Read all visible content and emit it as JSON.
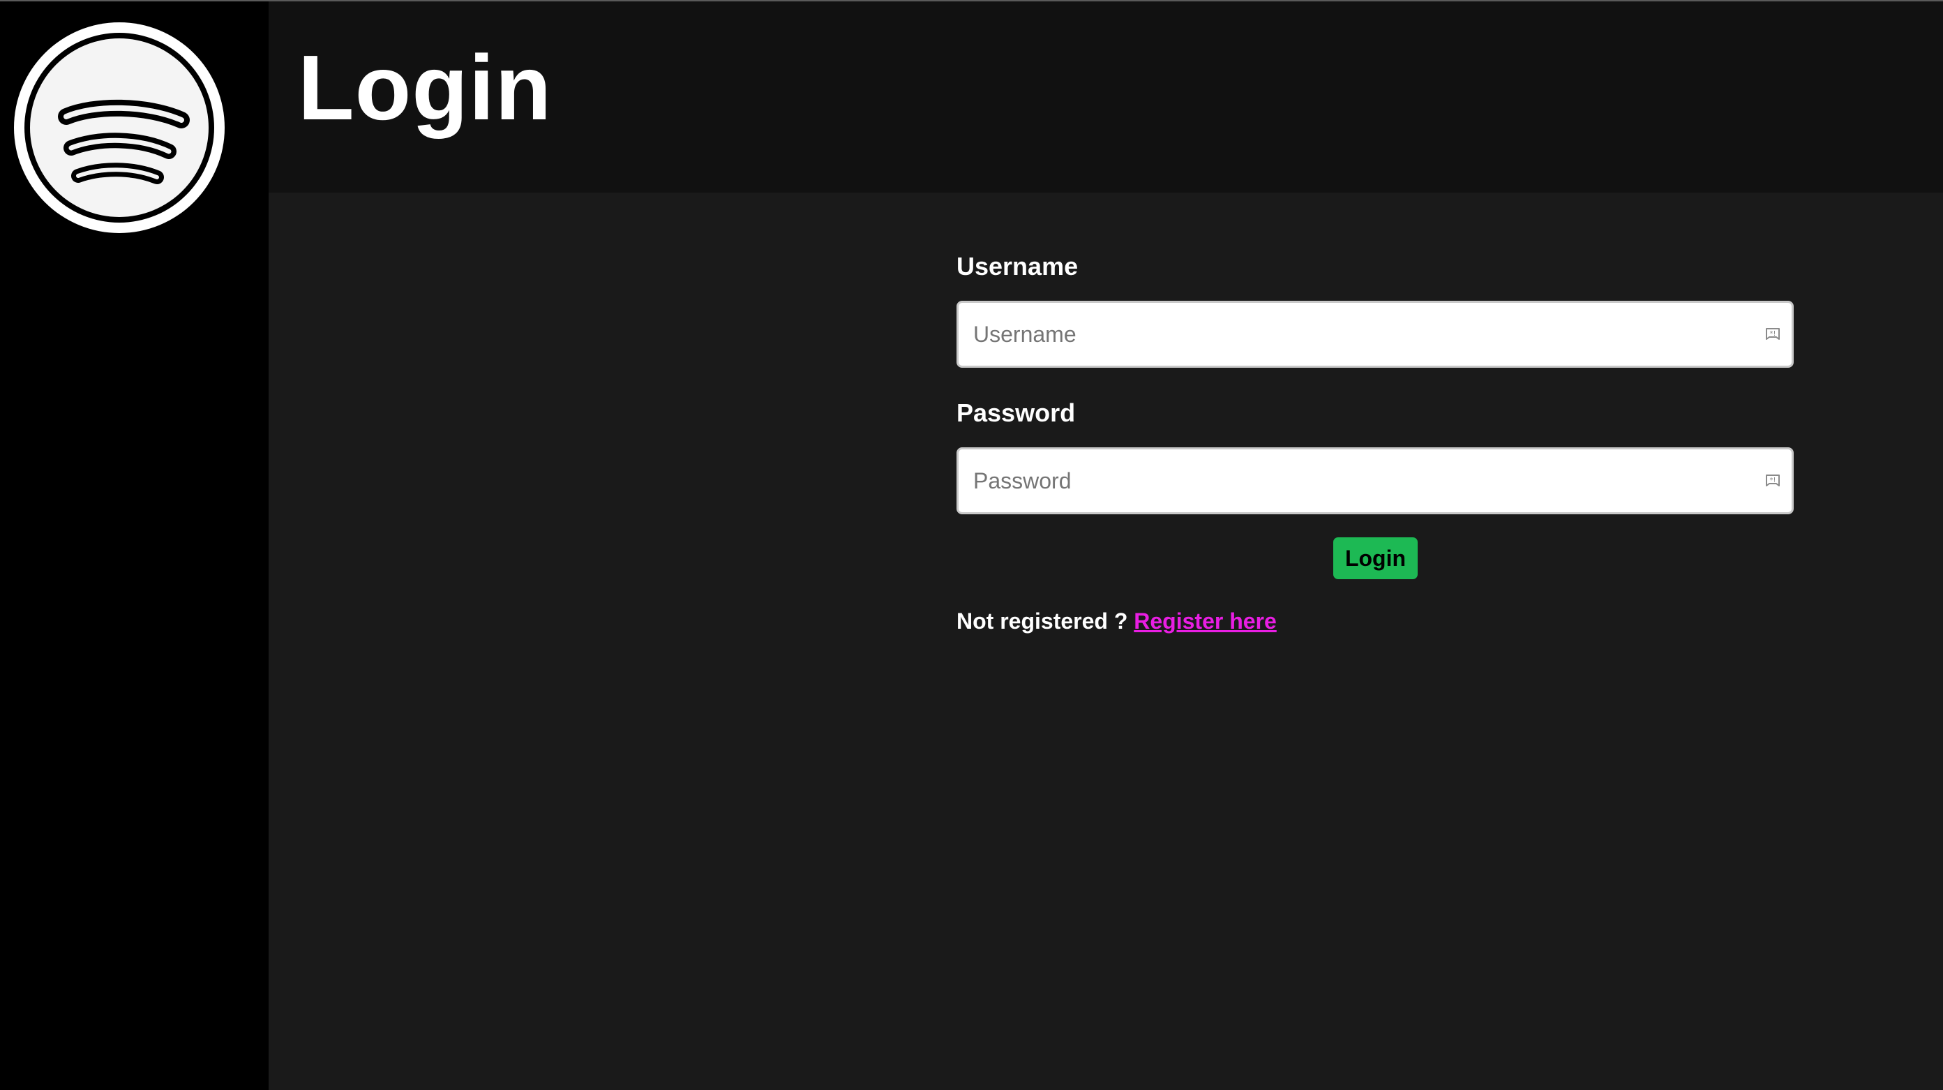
{
  "header": {
    "title": "Login"
  },
  "sidebar": {
    "logo_icon": "spotify-logo-icon"
  },
  "form": {
    "username_label": "Username",
    "username_placeholder": "Username",
    "username_value": "",
    "password_label": "Password",
    "password_placeholder": "Password",
    "password_value": "",
    "autofill_icon": "autofill-key-icon",
    "login_label": "Login",
    "register_prompt": "Not registered ?",
    "register_link": "Register here"
  },
  "colors": {
    "accent": "#1db954",
    "link": "#e91ee3",
    "sidebar_bg": "#000000",
    "header_bg": "#111111",
    "main_bg": "#1a1a1a"
  }
}
